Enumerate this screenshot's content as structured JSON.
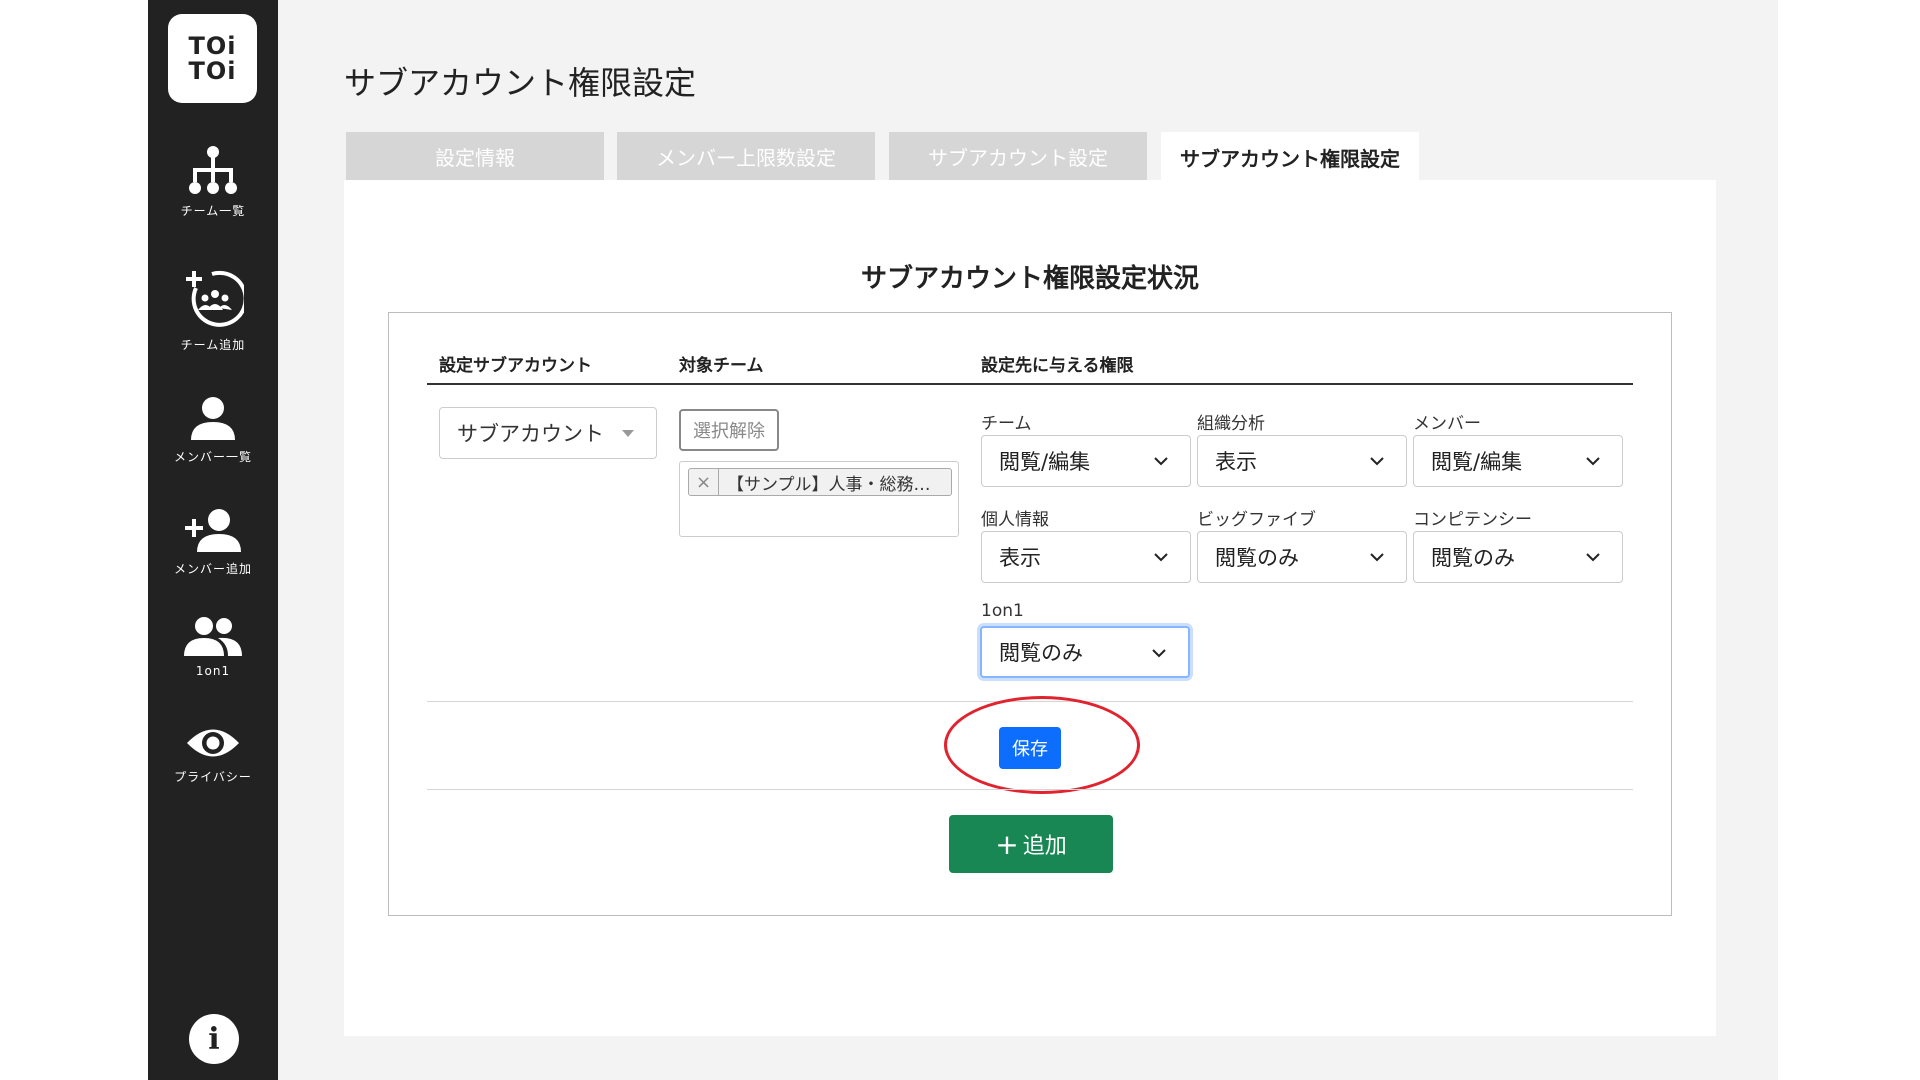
{
  "logo": {
    "line1": "TOi",
    "line2": "TOi"
  },
  "sidebar": {
    "items": [
      {
        "label": "チーム一覧",
        "icon": "org-chart-icon"
      },
      {
        "label": "チーム追加",
        "icon": "add-team-icon"
      },
      {
        "label": "メンバー一覧",
        "icon": "person-icon"
      },
      {
        "label": "メンバー追加",
        "icon": "add-person-icon"
      },
      {
        "label": "1on1",
        "icon": "people-icon"
      },
      {
        "label": "プライバシー",
        "icon": "eye-icon"
      }
    ],
    "info": "i"
  },
  "page": {
    "title": "サブアカウント権限設定"
  },
  "tabs": [
    {
      "label": "設定情報",
      "active": false
    },
    {
      "label": "メンバー上限数設定",
      "active": false
    },
    {
      "label": "サブアカウント設定",
      "active": false
    },
    {
      "label": "サブアカウント権限設定",
      "active": true
    }
  ],
  "section": {
    "title": "サブアカウント権限設定状況",
    "headers": {
      "subaccount": "設定サブアカウント",
      "team": "対象チーム",
      "permissions": "設定先に与える権限"
    }
  },
  "row": {
    "subaccount_select": "サブアカウント",
    "clear_button": "選択解除",
    "team_tag": "【サンプル】人事・総務…",
    "tag_remove": "×",
    "permissions": [
      {
        "label": "チーム",
        "value": "閲覧/編集"
      },
      {
        "label": "組織分析",
        "value": "表示"
      },
      {
        "label": "メンバー",
        "value": "閲覧/編集"
      },
      {
        "label": "個人情報",
        "value": "表示"
      },
      {
        "label": "ビッグファイブ",
        "value": "閲覧のみ"
      },
      {
        "label": "コンピテンシー",
        "value": "閲覧のみ"
      },
      {
        "label": "1on1",
        "value": "閲覧のみ"
      }
    ]
  },
  "actions": {
    "save": "保存",
    "add_plus": "+",
    "add": "追加"
  },
  "colors": {
    "sidebar": "#222222",
    "primary": "#0d6efd",
    "success": "#198754",
    "highlight": "#e0232e"
  }
}
